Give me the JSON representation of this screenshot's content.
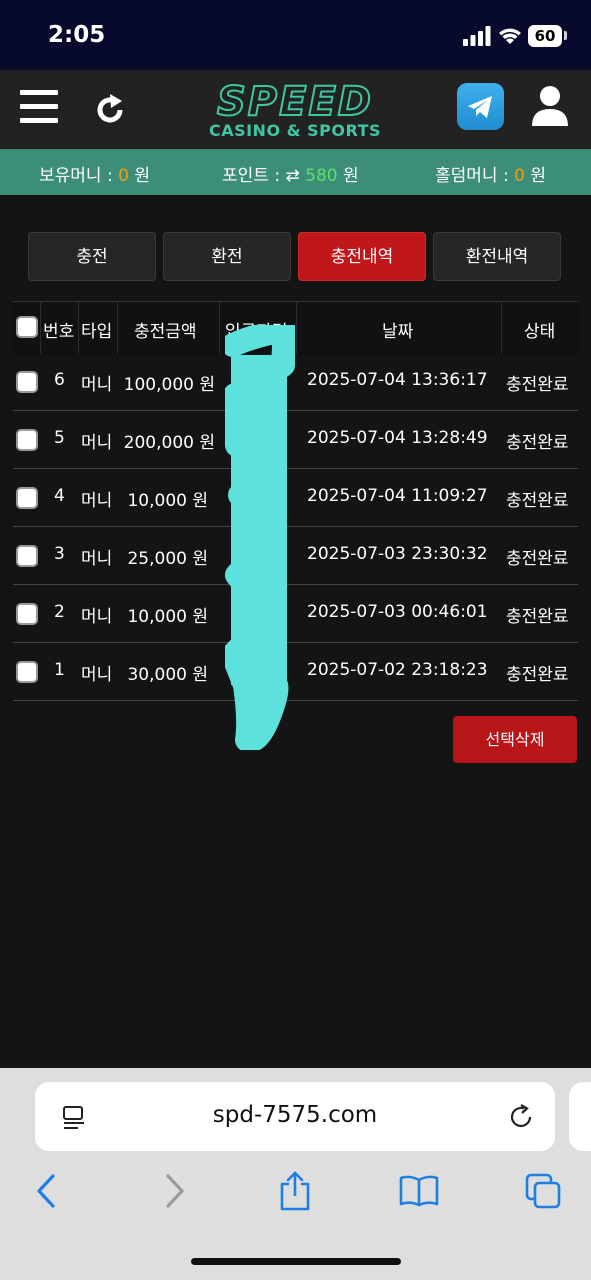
{
  "status": {
    "time": "2:05",
    "battery": "60"
  },
  "header": {
    "logo_main": "SPEED",
    "logo_sub": "CASINO & SPORTS"
  },
  "info": {
    "money_label": "보유머니 :",
    "money_value": "0",
    "money_unit": "원",
    "point_label": "포인트 :",
    "point_icon": "⇄",
    "point_value": "580",
    "point_unit": "원",
    "holdem_label": "홀덤머니 :",
    "holdem_value": "0",
    "holdem_unit": "원"
  },
  "tabs": [
    "충전",
    "환전",
    "충전내역",
    "환전내역"
  ],
  "active_tab": "충전내역",
  "table": {
    "headers": [
      "번호",
      "타입",
      "충전금액",
      "입금자명",
      "날짜",
      "상태"
    ],
    "rows": [
      {
        "no": "6",
        "type": "머니",
        "amount": "100,000 원",
        "date": "2025-07-04 13:36:17",
        "status": "충전완료"
      },
      {
        "no": "5",
        "type": "머니",
        "amount": "200,000 원",
        "date": "2025-07-04 13:28:49",
        "status": "충전완료"
      },
      {
        "no": "4",
        "type": "머니",
        "amount": "10,000 원",
        "date": "2025-07-04 11:09:27",
        "status": "충전완료"
      },
      {
        "no": "3",
        "type": "머니",
        "amount": "25,000 원",
        "date": "2025-07-03 23:30:32",
        "status": "충전완료"
      },
      {
        "no": "2",
        "type": "머니",
        "amount": "10,000 원",
        "date": "2025-07-03 00:46:01",
        "status": "충전완료"
      },
      {
        "no": "1",
        "type": "머니",
        "amount": "30,000 원",
        "date": "2025-07-02 23:18:23",
        "status": "충전완료"
      }
    ]
  },
  "delete_button": "선택삭제",
  "browser": {
    "url": "spd-7575.com"
  },
  "colors": {
    "accent_green": "#3d8e78",
    "active_red": "#c0171b",
    "orange": "#f39c12",
    "point_green": "#5ce06c"
  }
}
